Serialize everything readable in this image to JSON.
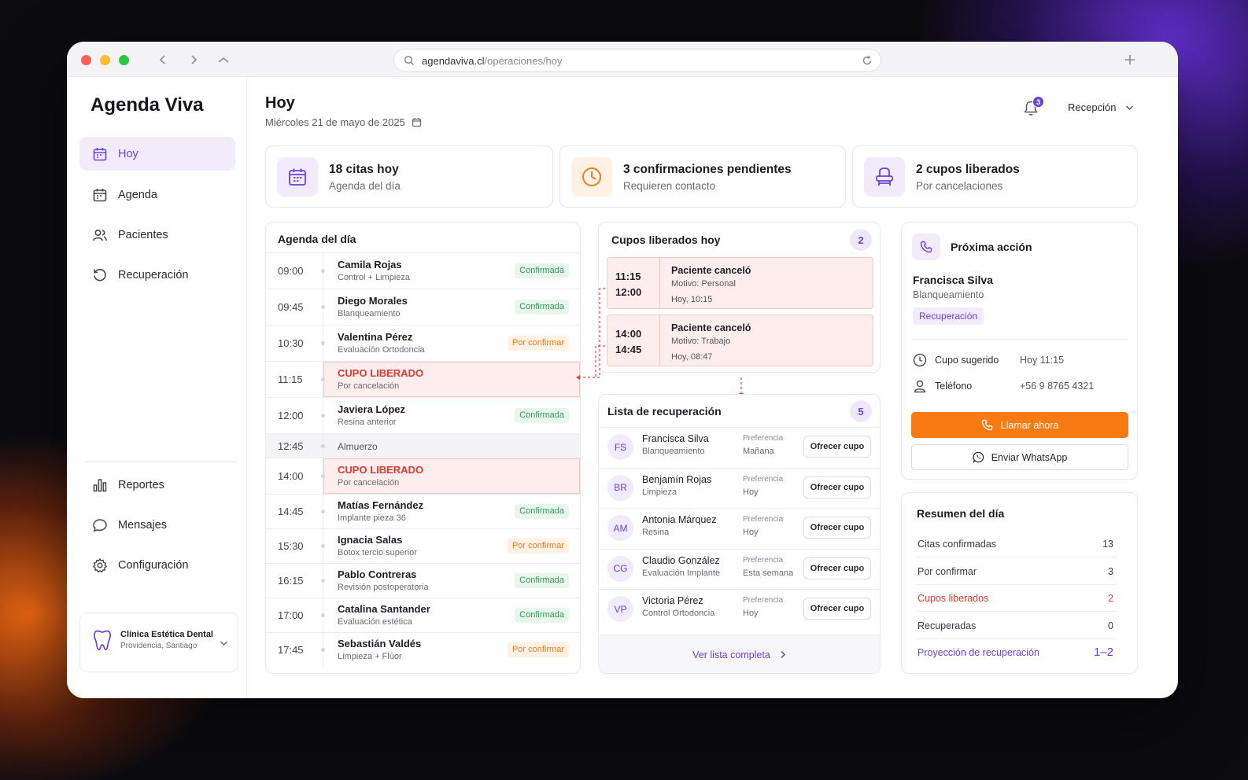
{
  "browser": {
    "url_domain": "agendaviva.cl",
    "url_path": "/operaciones/hoy"
  },
  "sidebar": {
    "brand": "Agenda Viva",
    "items": [
      {
        "label": "Hoy",
        "icon": "calendar-icon",
        "active": true
      },
      {
        "label": "Agenda",
        "icon": "calendar-icon"
      },
      {
        "label": "Pacientes",
        "icon": "users-icon"
      },
      {
        "label": "Recuperación",
        "icon": "rotate-icon"
      }
    ],
    "bottom_items": [
      {
        "label": "Reportes",
        "icon": "bar-chart-icon"
      },
      {
        "label": "Mensajes",
        "icon": "message-icon"
      },
      {
        "label": "Configuración",
        "icon": "gear-icon"
      }
    ],
    "clinic": {
      "name": "Clínica Estética Dental",
      "location": "Providencia, Santiago"
    }
  },
  "header": {
    "title": "Hoy",
    "date": "Miércoles 21 de mayo de 2025",
    "notifications": "3",
    "role": "Recepción"
  },
  "stats": [
    {
      "title": "18 citas hoy",
      "subtitle": "Agenda del día",
      "icon": "calendar-icon",
      "color": "#6a42d6"
    },
    {
      "title": "3 confirmaciones pendientes",
      "subtitle": "Requieren contacto",
      "icon": "clock-icon",
      "color": "#f07c1a"
    },
    {
      "title": "2 cupos liberados",
      "subtitle": "Por cancelaciones",
      "icon": "chair-icon",
      "color": "#6a42d6"
    }
  ],
  "agenda": {
    "title": "Agenda del día",
    "rows": [
      {
        "time": "09:00",
        "name": "Camila Rojas",
        "detail": "Control + Limpieza",
        "status": "Confirmada",
        "kind": "ok"
      },
      {
        "time": "09:45",
        "name": "Diego Morales",
        "detail": "Blanqueamiento",
        "status": "Confirmada",
        "kind": "ok"
      },
      {
        "time": "10:30",
        "name": "Valentina Pérez",
        "detail": "Evaluación Ortodoncia",
        "status": "Por confirmar",
        "kind": "pend"
      },
      {
        "time": "11:15",
        "name": "CUPO LIBERADO",
        "detail": "Por cancelación",
        "status": "",
        "kind": "free"
      },
      {
        "time": "12:00",
        "name": "Javiera López",
        "detail": "Resina anterior",
        "status": "Confirmada",
        "kind": "ok"
      },
      {
        "time": "12:45",
        "name": "Almuerzo",
        "detail": "",
        "status": "",
        "kind": "lunch"
      },
      {
        "time": "14:00",
        "name": "CUPO LIBERADO",
        "detail": "Por cancelación",
        "status": "",
        "kind": "free"
      },
      {
        "time": "14:45",
        "name": "Matías Fernández",
        "detail": "Implante pieza 36",
        "status": "Confirmada",
        "kind": "ok"
      },
      {
        "time": "15:30",
        "name": "Ignacia Salas",
        "detail": "Botox tercio superior",
        "status": "Por confirmar",
        "kind": "pend"
      },
      {
        "time": "16:15",
        "name": "Pablo Contreras",
        "detail": "Revisión postoperatoria",
        "status": "Confirmada",
        "kind": "ok"
      },
      {
        "time": "17:00",
        "name": "Catalina Santander",
        "detail": "Evaluación estética",
        "status": "Confirmada",
        "kind": "ok"
      },
      {
        "time": "17:45",
        "name": "Sebastián Valdés",
        "detail": "Limpieza + Flúor",
        "status": "Por confirmar",
        "kind": "pend"
      }
    ]
  },
  "freed": {
    "title": "Cupos liberados hoy",
    "count": "2",
    "slots": [
      {
        "start": "11:15",
        "end": "12:00",
        "title": "Paciente canceló",
        "reason": "Motivo: Personal",
        "when": "Hoy, 10:15"
      },
      {
        "start": "14:00",
        "end": "14:45",
        "title": "Paciente canceló",
        "reason": "Motivo: Trabajo",
        "when": "Hoy, 08:47"
      }
    ]
  },
  "recovery": {
    "title": "Lista de recuperación",
    "count": "5",
    "pref_label": "Preferencia",
    "offer_label": "Ofrecer cupo",
    "rows": [
      {
        "initials": "FS",
        "name": "Francisca Silva",
        "treatment": "Blanqueamiento",
        "pref": "Mañana"
      },
      {
        "initials": "BR",
        "name": "Benjamín Rojas",
        "treatment": "Limpieza",
        "pref": "Hoy"
      },
      {
        "initials": "AM",
        "name": "Antonia Márquez",
        "treatment": "Resina",
        "pref": "Hoy"
      },
      {
        "initials": "CG",
        "name": "Claudio González",
        "treatment": "Evaluación Implante",
        "pref": "Esta semana"
      },
      {
        "initials": "VP",
        "name": "Victoria Pérez",
        "treatment": "Control Ortodoncia",
        "pref": "Hoy"
      }
    ],
    "see_all": "Ver lista completa"
  },
  "next_action": {
    "title": "Próxima acción",
    "patient": "Francisca Silva",
    "treatment": "Blanqueamiento",
    "tag": "Recuperación",
    "slot_label": "Cupo sugerido",
    "slot_value": "Hoy 11:15",
    "phone_label": "Teléfono",
    "phone_value": "+56 9 8765 4321",
    "call_label": "Llamar ahora",
    "whatsapp_label": "Enviar WhatsApp",
    "accent": "#f77a12"
  },
  "summary": {
    "title": "Resumen del día",
    "rows": [
      {
        "label": "Citas confirmadas",
        "value": "13",
        "style": "normal"
      },
      {
        "label": "Por confirmar",
        "value": "3",
        "style": "normal"
      },
      {
        "label": "Cupos liberados",
        "value": "2",
        "style": "red"
      },
      {
        "label": "Recuperadas",
        "value": "0",
        "style": "normal"
      },
      {
        "label": "Proyección de recuperación",
        "value": "1–2",
        "style": "purple"
      }
    ]
  }
}
